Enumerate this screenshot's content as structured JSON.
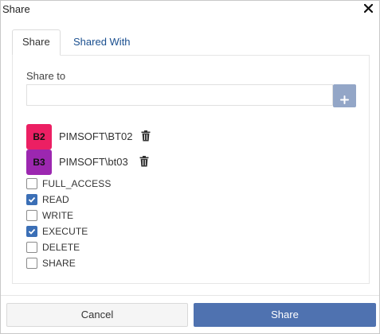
{
  "dialog": {
    "title": "Share"
  },
  "tabs": [
    {
      "label": "Share",
      "active": true
    },
    {
      "label": "Shared With",
      "active": false
    }
  ],
  "share_to": {
    "label": "Share to",
    "value": "",
    "placeholder": "",
    "add_icon": "plus-icon"
  },
  "users": [
    {
      "initials": "B2",
      "name": "PIMSOFT\\BT02",
      "color": "#ec1f63",
      "remove_icon": "trash-icon"
    },
    {
      "initials": "B3",
      "name": "PIMSOFT\\bt03",
      "color": "#9c27b0",
      "remove_icon": "trash-icon"
    }
  ],
  "permissions": [
    {
      "label": "FULL_ACCESS",
      "checked": false
    },
    {
      "label": "READ",
      "checked": true
    },
    {
      "label": "WRITE",
      "checked": false
    },
    {
      "label": "EXECUTE",
      "checked": true
    },
    {
      "label": "DELETE",
      "checked": false
    },
    {
      "label": "SHARE",
      "checked": false
    }
  ],
  "footer": {
    "cancel_label": "Cancel",
    "share_label": "Share"
  },
  "colors": {
    "primary": "#4f72b0",
    "add_button": "#93a6c7",
    "checkbox_checked": "#3b6fb6",
    "tab_link": "#1a4f8f"
  }
}
